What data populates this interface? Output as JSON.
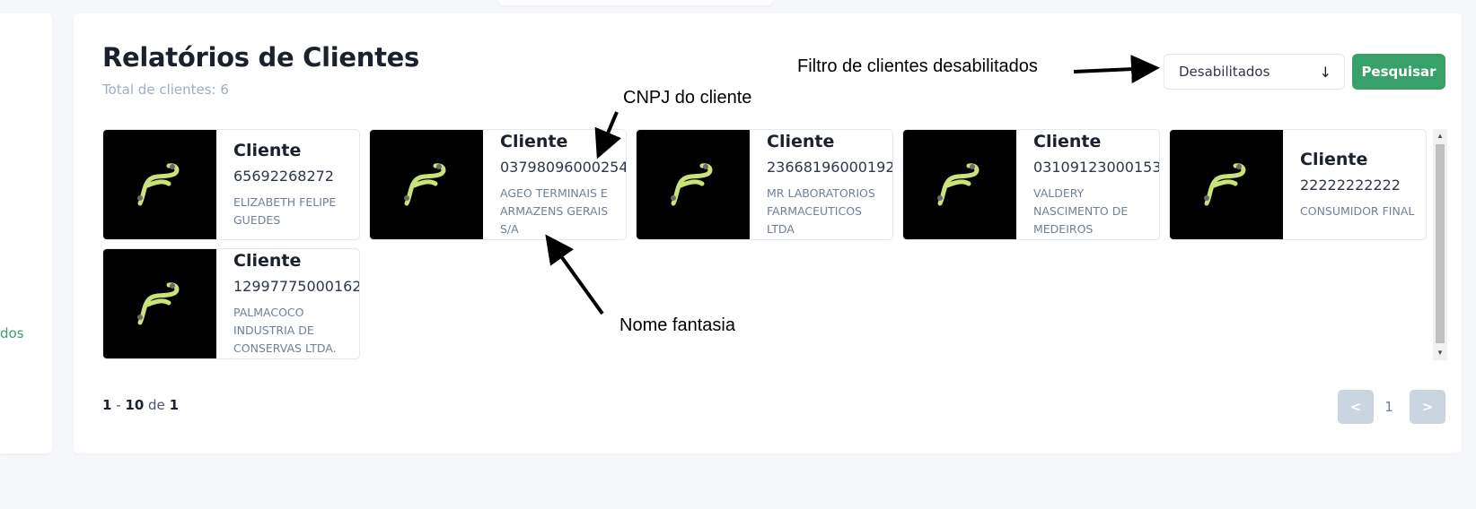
{
  "sidebar": {
    "partial_link": "dos"
  },
  "header": {
    "title": "Relatórios de Clientes",
    "subtitle": "Total de clientes: 6"
  },
  "filter": {
    "selected": "Desabilitados",
    "icon": "arrow-down-icon"
  },
  "search_button": {
    "label": "Pesquisar"
  },
  "clients": [
    {
      "title": "Cliente",
      "cnpj": "65692268272",
      "name_lines": [
        "ELIZABETH FELIPE",
        "GUEDES"
      ]
    },
    {
      "title": "Cliente",
      "cnpj": "03798096000254",
      "name_lines": [
        "AGEO TERMINAIS E",
        "ARMAZENS GERAIS",
        "S/A"
      ]
    },
    {
      "title": "Cliente",
      "cnpj": "23668196000192",
      "name_lines": [
        "MR LABORATORIOS",
        "FARMACEUTICOS",
        "LTDA"
      ]
    },
    {
      "title": "Cliente",
      "cnpj": "03109123000153",
      "name_lines": [
        "VALDERY",
        "NASCIMENTO DE",
        "MEDEIROS"
      ]
    },
    {
      "title": "Cliente",
      "cnpj": "22222222222",
      "name_lines": [
        "CONSUMIDOR FINAL"
      ]
    },
    {
      "title": "Cliente",
      "cnpj": "12997775000162",
      "name_lines": [
        "PALMACOCO",
        "INDUSTRIA DE",
        "CONSERVAS LTDA."
      ]
    }
  ],
  "pagination": {
    "range_start": "1",
    "separator": " - ",
    "range_end": "10",
    "of_label": " de ",
    "total": "1",
    "prev_label": "<",
    "current_page": "1",
    "next_label": ">"
  },
  "annotations": {
    "filter_note": "Filtro de clientes desabilitados",
    "cnpj_note": "CNPJ do cliente",
    "name_note": "Nome fantasia"
  },
  "colors": {
    "accent": "#38a169",
    "logo_bg": "#000000",
    "logo_stroke": "#c9e27a",
    "pager_disabled": "#cbd5e0"
  }
}
